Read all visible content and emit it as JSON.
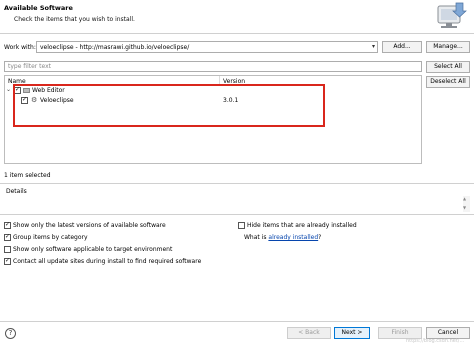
{
  "header": {
    "title": "Available Software",
    "description": "Check the items that you wish to install."
  },
  "work_with": {
    "label": "Work with:",
    "value": "veloeclipse - http://masrawi.github.io/veloeclipse/",
    "add_button": "Add...",
    "manage_button": "Manage..."
  },
  "filter": {
    "placeholder": "type filter text",
    "select_all": "Select All",
    "deselect_all": "Deselect All"
  },
  "tree": {
    "columns": [
      "Name",
      "Version"
    ],
    "category": {
      "label": "Web Editor",
      "checked": true
    },
    "items": [
      {
        "label": "Veloeclipse",
        "version": "3.0.1",
        "checked": true
      }
    ]
  },
  "status": {
    "selected": "1 item selected"
  },
  "details": {
    "label": "Details"
  },
  "options": {
    "latest_versions": {
      "label": "Show only the latest versions of available software",
      "checked": true
    },
    "group_by_category": {
      "label": "Group items by category",
      "checked": true
    },
    "target_env": {
      "label": "Show only software applicable to target environment",
      "checked": false
    },
    "contact_sites": {
      "label": "Contact all update sites during install to find required software",
      "checked": true
    },
    "hide_installed": {
      "label": "Hide items that are already installed",
      "checked": false
    },
    "what_is_prefix": "What is",
    "already_installed_link": "already installed",
    "what_is_suffix": "?"
  },
  "footer": {
    "back": "< Back",
    "next": "Next >",
    "finish": "Finish",
    "cancel": "Cancel"
  },
  "watermark": "https://blog.csdn.net/..."
}
